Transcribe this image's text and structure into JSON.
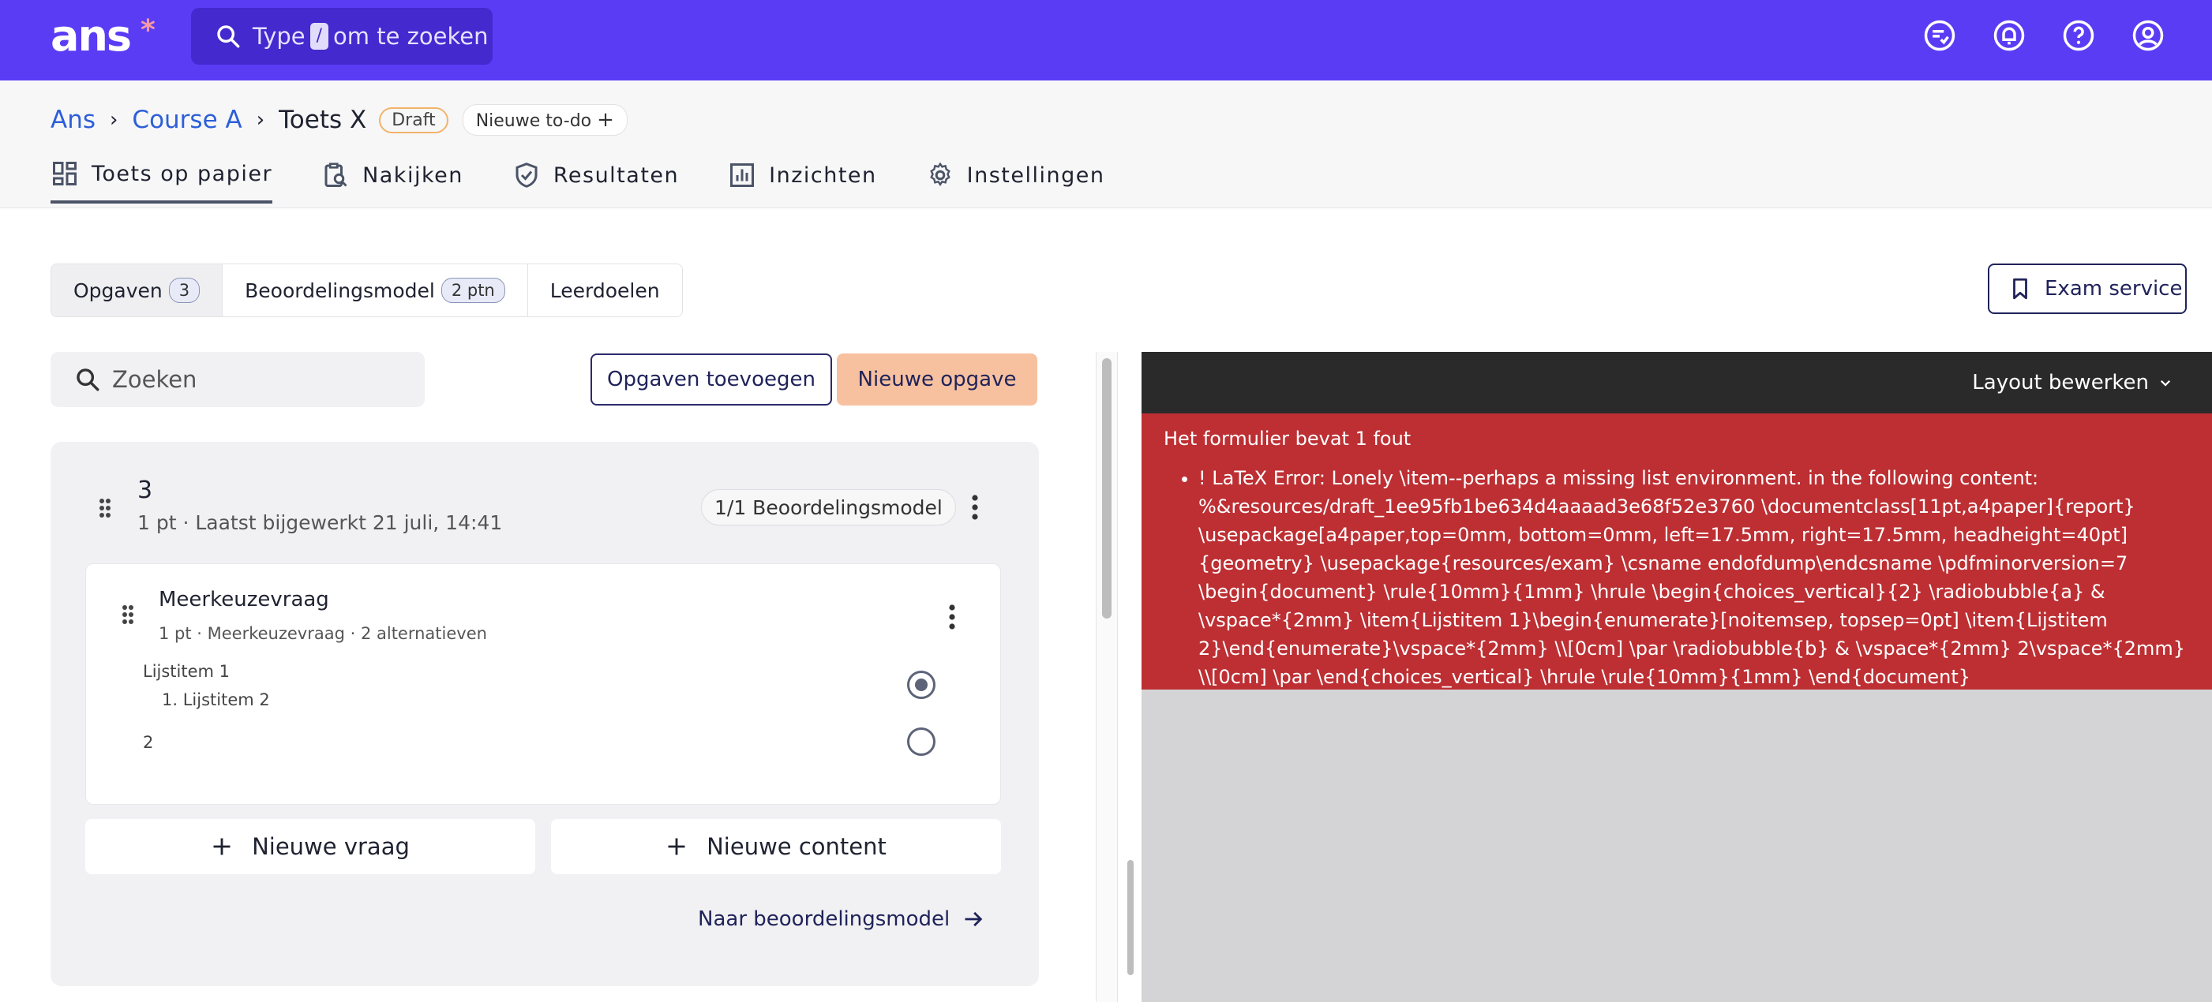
{
  "topbar": {
    "logo": "ans",
    "logo_star": "*",
    "search_prefix": "Type",
    "search_key": "/",
    "search_suffix": "om te zoeken"
  },
  "breadcrumb": {
    "items": [
      "Ans",
      "Course A"
    ],
    "current": "Toets X",
    "status_badge": "Draft",
    "todo_label": "Nieuwe to-do"
  },
  "tabs": [
    {
      "label": "Toets op papier",
      "icon": "dashboard-icon",
      "active": true
    },
    {
      "label": "Nakijken",
      "icon": "clipboard-search-icon"
    },
    {
      "label": "Resultaten",
      "icon": "shield-check-icon"
    },
    {
      "label": "Inzichten",
      "icon": "bar-chart-icon"
    },
    {
      "label": "Instellingen",
      "icon": "gear-icon"
    }
  ],
  "segments": [
    {
      "label": "Opgaven",
      "count": "3"
    },
    {
      "label": "Beoordelingsmodel",
      "count": "2 ptn"
    },
    {
      "label": "Leerdoelen"
    }
  ],
  "exam_service_label": "Exam service",
  "left": {
    "search_placeholder": "Zoeken",
    "add_existing_label": "Opgaven toevoegen",
    "new_exercise_label": "Nieuwe opgave",
    "group": {
      "title": "3",
      "subtitle": "1 pt · Laatst bijgewerkt 21 juli, 14:41",
      "model_badge": "1/1 Beoordelingsmodel"
    },
    "question": {
      "title": "Meerkeuzevraag",
      "subtitle": "1 pt · Meerkeuzevraag · 2 alternatieven",
      "option1_line1": "Lijstitem 1",
      "option1_line2": "1. Lijstitem 2",
      "option2": "2",
      "selected_option": 1
    },
    "new_question_label": "Nieuwe vraag",
    "new_content_label": "Nieuwe content",
    "to_model_label": "Naar beoordelingsmodel"
  },
  "preview": {
    "layout_label": "Layout bewerken",
    "error_title": "Het formulier bevat 1 fout",
    "error_message": "! LaTeX Error: Lonely \\item--perhaps a missing list environment. in the following content: %&resources/draft_1ee95fb1be634d4aaaad3e68f52e3760 \\documentclass[11pt,a4paper]{report} \\usepackage[a4paper,top=0mm, bottom=0mm, left=17.5mm, right=17.5mm, headheight=40pt]{geometry} \\usepackage{resources/exam} \\csname endofdump\\endcsname \\pdfminorversion=7 \\begin{document} \\rule{10mm}{1mm} \\hrule \\begin{choices_vertical}{2} \\radiobubble{a} & \\vspace*{2mm} \\item{Lijstitem 1}\\begin{enumerate}[noitemsep, topsep=0pt] \\item{Lijstitem 2}\\end{enumerate}\\vspace*{2mm} \\\\[0cm] \\par \\radiobubble{b} & \\vspace*{2mm} 2\\vspace*{2mm} \\\\[0cm] \\par \\end{choices_vertical} \\hrule \\rule{10mm}{1mm} \\end{document}"
  },
  "colors": {
    "brand": "#5b3cf5",
    "error": "#bd2f33",
    "primary_button": "#f7c19f"
  }
}
